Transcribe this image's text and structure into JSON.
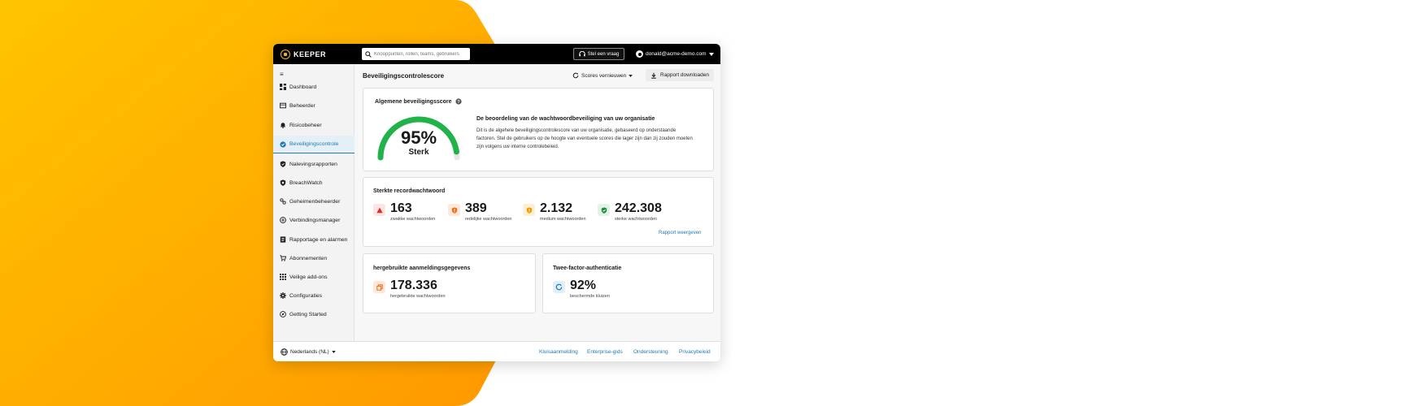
{
  "brand": {
    "name": "KEEPER",
    "accent": "#f5b800"
  },
  "search": {
    "placeholder": "Knooppunten, rollen, teams, gebruikers"
  },
  "topbar": {
    "ask_label": "Stel een vraag",
    "user_email": "donald@acme-demo.com"
  },
  "sidebar": {
    "items": [
      {
        "label": "Dashboard",
        "icon": "dashboard-icon"
      },
      {
        "label": "Beheerder",
        "icon": "admin-icon"
      },
      {
        "label": "Risicobeheer",
        "icon": "bell-icon"
      },
      {
        "label": "Beveiligingscontrole",
        "icon": "shield-check-icon",
        "active": true
      },
      {
        "label": "Nalevingsrapporten",
        "icon": "shield-icon"
      },
      {
        "label": "BreachWatch",
        "icon": "breachwatch-icon"
      },
      {
        "label": "Geheimenbeheerder",
        "icon": "secrets-icon"
      },
      {
        "label": "Verbindingsmanager",
        "icon": "connection-icon"
      },
      {
        "label": "Rapportage en alarmen",
        "icon": "report-icon"
      },
      {
        "label": "Abonnementen",
        "icon": "cart-icon"
      },
      {
        "label": "Veilige add-ons",
        "icon": "grid-icon"
      },
      {
        "label": "Configuraties",
        "icon": "gear-icon"
      },
      {
        "label": "Getting Started",
        "icon": "rocket-icon"
      }
    ]
  },
  "main": {
    "page_title": "Beveiligingscontrolescore",
    "refresh_label": "Scores vernieuwen",
    "download_label": "Rapport downloaden",
    "overall": {
      "title": "Algemene beveiligingsscore",
      "score_text": "95%",
      "score_fraction": 0.95,
      "rating": "Sterk",
      "desc_title": "De beoordeling van de wachtwoordbeveiliging van uw organisatie",
      "desc_text": "Dit is de algehele beveiligingscontrolescore van uw organisatie, gebaseerd op onderstaande factoren.  Stel de gebruikers op de hoogte van eventuele scores die lager zijn dan zij zouden moeten zijn volgens uw interne controlebeleid."
    },
    "strength": {
      "title": "Sterkte recordwachtwoord",
      "stats": [
        {
          "value": "163",
          "label": "zwakke wachtwoorden",
          "color": "#d93025",
          "bg": "#fde4e2"
        },
        {
          "value": "389",
          "label": "redelijke wachtwoorden",
          "color": "#e8711c",
          "bg": "#fde8d9"
        },
        {
          "value": "2.132",
          "label": "medium wachtwoorden",
          "color": "#f29900",
          "bg": "#fdefd5"
        },
        {
          "value": "242.308",
          "label": "sterke wachtwoorden",
          "color": "#1e8e3e",
          "bg": "#e2f3e6"
        }
      ],
      "link": "Rapport weergeven"
    },
    "reused": {
      "title": "hergebruikte aanmeldingsgegevens",
      "value": "178.336",
      "label": "hergebruikte wachtwoorden",
      "color": "#e8711c",
      "bg": "#fde8d9"
    },
    "twofa": {
      "title": "Twee-factor-authenticatie",
      "value": "92%",
      "label": "beschermde kluizen",
      "color": "#1f7bb5",
      "bg": "#e3eff8"
    }
  },
  "footer": {
    "language": "Nederlands (NL)",
    "links": [
      "Kluisaanmelding",
      "Enterprise-gids",
      "Ondersteuning",
      "Privacybeleid"
    ]
  },
  "colors": {
    "gauge": "#1fb34a",
    "link": "#1f7bb5",
    "background_gradient": [
      "#ffc400",
      "#ff9f00"
    ]
  }
}
